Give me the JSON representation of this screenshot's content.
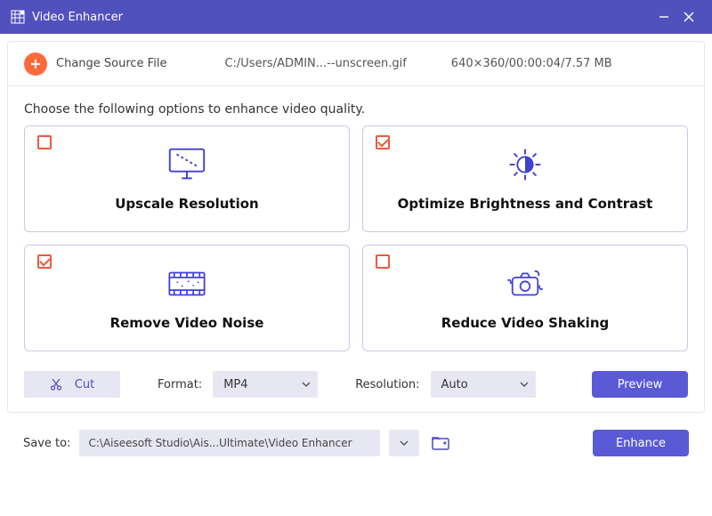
{
  "window": {
    "title": "Video Enhancer"
  },
  "source": {
    "change_label": "Change Source File",
    "path": "C:/Users/ADMIN...--unscreen.gif",
    "meta": "640×360/00:00:04/7.57 MB"
  },
  "instructions": "Choose the following options to enhance video quality.",
  "options": {
    "upscale": {
      "label": "Upscale Resolution",
      "checked": false
    },
    "brightness": {
      "label": "Optimize Brightness and Contrast",
      "checked": true
    },
    "noise": {
      "label": "Remove Video Noise",
      "checked": true
    },
    "shaking": {
      "label": "Reduce Video Shaking",
      "checked": false
    }
  },
  "controls": {
    "cut_label": "Cut",
    "format_label": "Format:",
    "format_value": "MP4",
    "resolution_label": "Resolution:",
    "resolution_value": "Auto",
    "preview_label": "Preview"
  },
  "bottom": {
    "save_to_label": "Save to:",
    "save_path": "C:\\Aiseesoft Studio\\Ais...Ultimate\\Video Enhancer",
    "enhance_label": "Enhance"
  },
  "colors": {
    "primary": "#5151bd",
    "accent_orange": "#ff6a3d",
    "checkbox": "#ec5a3d",
    "icon_blue": "#4141d1"
  }
}
